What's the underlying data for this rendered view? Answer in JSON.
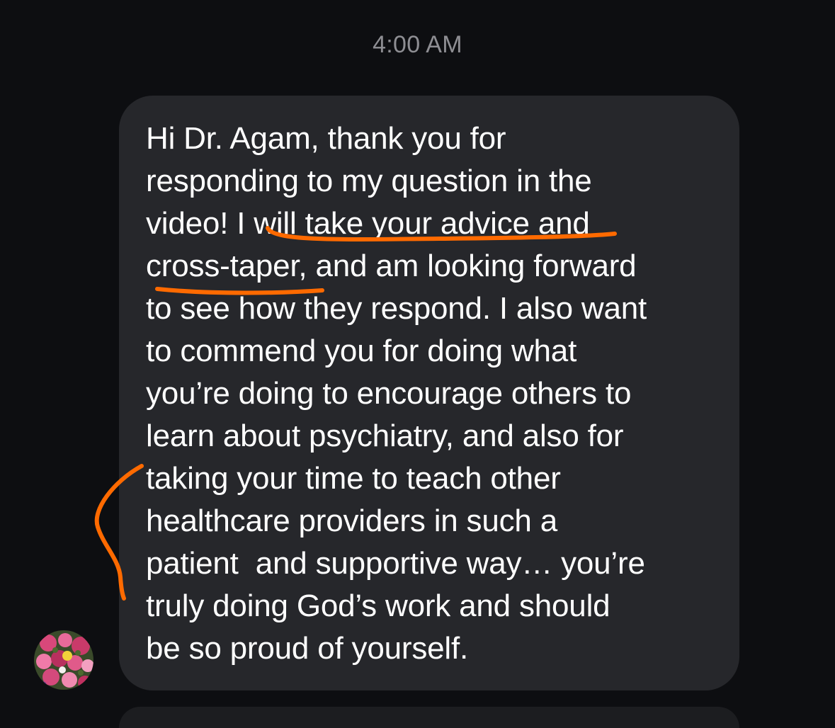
{
  "header": {
    "timestamp": "4:00 AM"
  },
  "message": {
    "lines": [
      "Hi Dr. Agam, thank you for",
      "responding to my question in the",
      "video! I will take your advice and",
      "cross-taper, and am looking forward",
      "to see how they respond. I also want",
      "to commend you for doing what",
      "you’re doing to encourage others to",
      "learn about psychiatry, and also for",
      "taking your time to teach other",
      "healthcare providers in such a",
      "patient  and supportive way… you’re",
      "truly doing God’s work and should",
      "be so proud of yourself."
    ]
  },
  "colors": {
    "background": "#0d0e11",
    "bubble": "#26272b",
    "text": "#ffffff",
    "timestamp": "#8e8e93",
    "annotation": "#ff6a00"
  },
  "avatar": {
    "icon": "flower-photo-avatar"
  }
}
